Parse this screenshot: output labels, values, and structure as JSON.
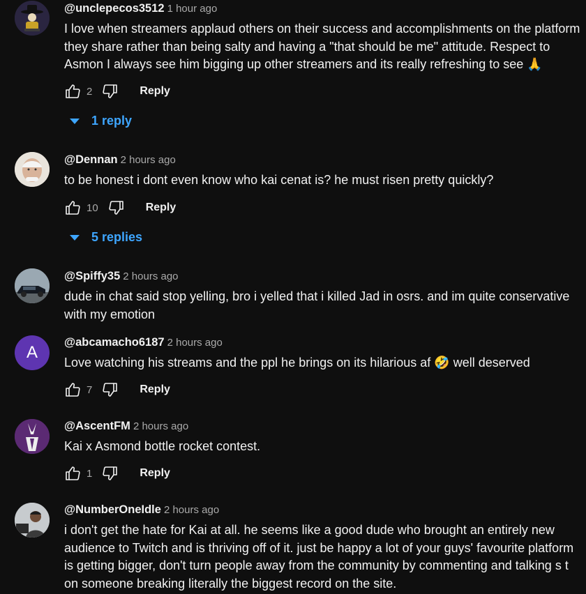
{
  "comments": [
    {
      "author": "@unclepecos3512",
      "time": "1 hour ago",
      "text": "I love when streamers applaud others on their success and accomplishments on the platform they share rather than being salty and having a \"that should be me\" attitude. Respect to Asmon I always see him bigging up other streamers and its really refreshing to see 🙏",
      "likes": "2",
      "reply_label": "Reply",
      "replies_label": "1 reply",
      "avatar_icon": "cowboy-avatar-icon"
    },
    {
      "author": "@Dennan",
      "time": "2 hours ago",
      "text": "to be honest i dont even know who kai cenat is? he must risen pretty quickly?",
      "likes": "10",
      "reply_label": "Reply",
      "replies_label": "5 replies",
      "avatar_icon": "face-avatar-icon"
    },
    {
      "author": "@Spiffy35",
      "time": "2 hours ago",
      "text": "dude in chat  said stop yelling, bro i yelled that i killed Jad in osrs. and im quite conservative with my emotion",
      "avatar_icon": "car-avatar-icon"
    },
    {
      "author": "@abcamacho6187",
      "time": "2 hours ago",
      "text": "Love watching his streams and the ppl he brings on its hilarious af 🤣 well deserved",
      "likes": "7",
      "reply_label": "Reply",
      "avatar_letter": "A",
      "avatar_color": "#5e35b1"
    },
    {
      "author": "@AscentFM",
      "time": "2 hours ago",
      "text": "Kai x Asmond bottle rocket contest.",
      "likes": "1",
      "reply_label": "Reply",
      "avatar_icon": "rabbit-avatar-icon"
    },
    {
      "author": "@NumberOneIdle",
      "time": "2 hours ago",
      "text": "i don't get the hate for Kai at all. he seems like a good dude who brought an entirely new audience to Twitch and is thriving off of it. just be happy a lot of your guys' favourite platform is getting bigger, don't turn people away from the community by commenting and talking s   t on someone breaking literally the biggest record on the site.",
      "avatar_icon": "person-avatar-icon"
    }
  ],
  "colors": {
    "background": "#0f0f0f",
    "text": "#f1f1f1",
    "muted": "#aaaaaa",
    "link": "#3ea6ff"
  }
}
